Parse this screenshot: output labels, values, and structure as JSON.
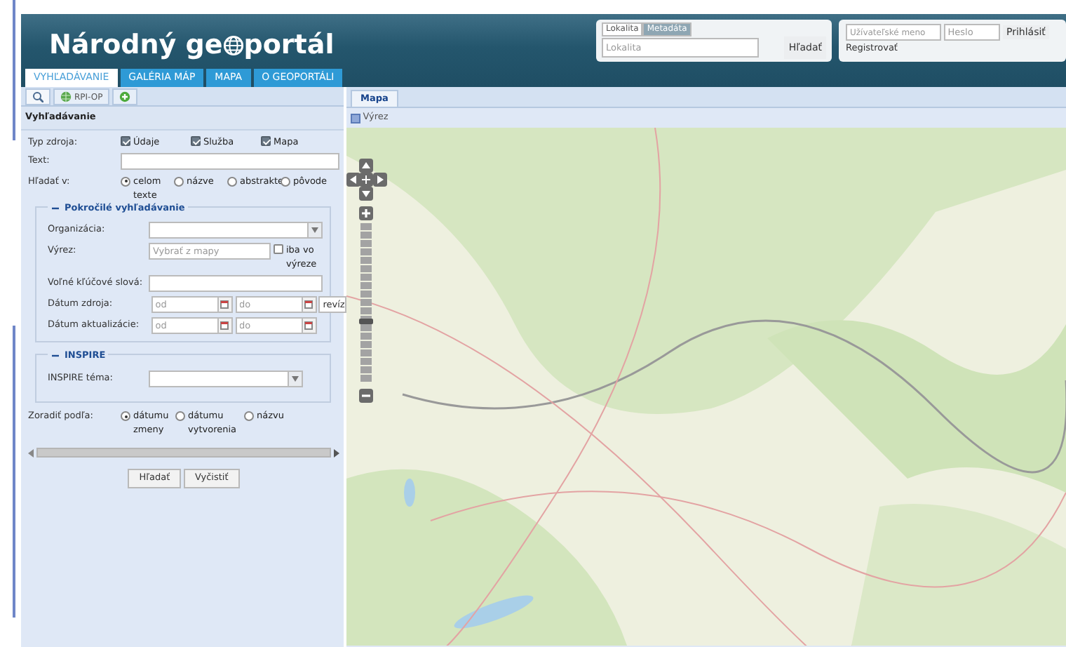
{
  "header": {
    "title_start": "Národný ge",
    "title_end": "portál"
  },
  "main_tabs": [
    {
      "label": "VYHĽADÁVANIE",
      "selected": true
    },
    {
      "label": "GALÉRIA MÁP",
      "selected": false
    },
    {
      "label": "MAPA",
      "selected": false
    },
    {
      "label": "O GEOPORTÁLI",
      "selected": false
    }
  ],
  "search_box": {
    "tabs": [
      {
        "label": "Lokalita",
        "selected": true
      },
      {
        "label": "Metadáta",
        "selected": false
      }
    ],
    "placeholder": "Lokalita",
    "button": "Hľadať"
  },
  "login": {
    "username_placeholder": "Užívateľské meno",
    "password_placeholder": "Heslo",
    "button": "Prihlásiť",
    "register_link": "Registrovať"
  },
  "left_panel": {
    "toolbar": [
      {
        "kind": "search",
        "selected": true
      },
      {
        "kind": "globe",
        "label": "RPI-OP",
        "selected": false
      },
      {
        "kind": "add",
        "selected": false
      }
    ],
    "title": "Vyhľadávanie",
    "resource_type": {
      "label": "Typ zdroja:",
      "options": [
        {
          "label": "Údaje",
          "checked": true
        },
        {
          "label": "Služba",
          "checked": true
        },
        {
          "label": "Mapa",
          "checked": true
        }
      ]
    },
    "text": {
      "label": "Text:"
    },
    "search_in": {
      "label": "Hľadať v:",
      "options": [
        {
          "label": "celom texte",
          "selected": true
        },
        {
          "label": "názve",
          "selected": false
        },
        {
          "label": "abstrakte",
          "selected": false
        },
        {
          "label": "pôvode",
          "selected": false
        }
      ]
    },
    "advanced": {
      "legend": "Pokročilé vyhľadávanie",
      "expanded": true,
      "organization": {
        "label": "Organizácia:"
      },
      "extent": {
        "label": "Výrez:",
        "placeholder": "Vybrať z mapy",
        "only_in_extent": {
          "label": "iba vo výreze",
          "checked": false
        }
      },
      "keywords": {
        "label": "Voľné kľúčové slová:"
      },
      "source_date": {
        "label": "Dátum zdroja:",
        "from_placeholder": "od",
        "to_placeholder": "do",
        "suffix": "revíz"
      },
      "update_date": {
        "label": "Dátum aktualizácie:",
        "from_placeholder": "od",
        "to_placeholder": "do"
      }
    },
    "inspire": {
      "legend": "INSPIRE",
      "expanded": true,
      "theme": {
        "label": "INSPIRE téma:"
      }
    },
    "sort": {
      "label": "Zoradiť podľa:",
      "options": [
        {
          "label": "dátumu zmeny",
          "selected": true
        },
        {
          "label": "dátumu vytvorenia",
          "selected": false
        },
        {
          "label": "názvu",
          "selected": false
        }
      ]
    },
    "buttons": [
      "Hľadať",
      "Vyčistiť"
    ]
  },
  "map_panel": {
    "tabs": [
      {
        "label": "Mapa",
        "selected": true
      }
    ],
    "toolbar": {
      "label": "Výrez"
    },
    "zoom_slider": {
      "level": 0.38
    }
  }
}
